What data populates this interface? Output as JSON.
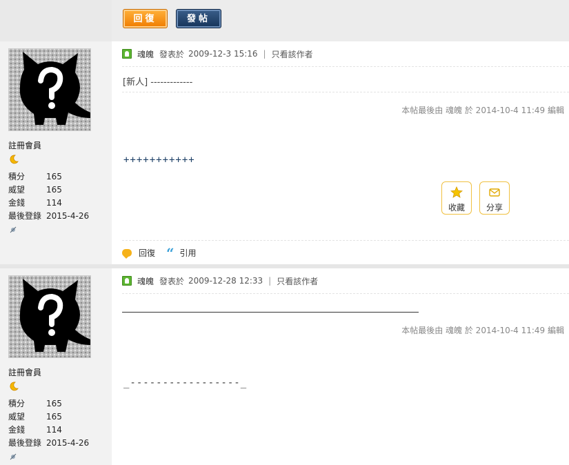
{
  "toolbar": {
    "reply_label": "回復",
    "post_label": "發帖"
  },
  "posts": [
    {
      "author": "魂魄",
      "posted_prefix": "發表於",
      "posted_time": "2009-12-3 15:16",
      "only_author": "只看該作者",
      "content_line1": "[新人] -------------",
      "edit_note": "本帖最後由 魂魄 於 2014-10-4 11:49 編輯",
      "content_line2": "+++++++++++",
      "favorite_label": "收藏",
      "share_label": "分享",
      "reply_label": "回復",
      "quote_label": "引用",
      "user_group": "註冊會員",
      "stats": [
        {
          "label": "積分",
          "value": "165"
        },
        {
          "label": "威望",
          "value": "165"
        },
        {
          "label": "金錢",
          "value": "114"
        },
        {
          "label": "最後登錄",
          "value": "2015-4-26"
        }
      ]
    },
    {
      "author": "魂魄",
      "posted_prefix": "發表於",
      "posted_time": "2009-12-28 12:33",
      "only_author": "只看該作者",
      "edit_note": "本帖最後由 魂魄 於 2014-10-4 11:49 編輯",
      "content_line2": "_-----------------_",
      "user_group": "註冊會員",
      "stats": [
        {
          "label": "積分",
          "value": "165"
        },
        {
          "label": "威望",
          "value": "165"
        },
        {
          "label": "金錢",
          "value": "114"
        },
        {
          "label": "最後登錄",
          "value": "2015-4-26"
        }
      ]
    }
  ]
}
